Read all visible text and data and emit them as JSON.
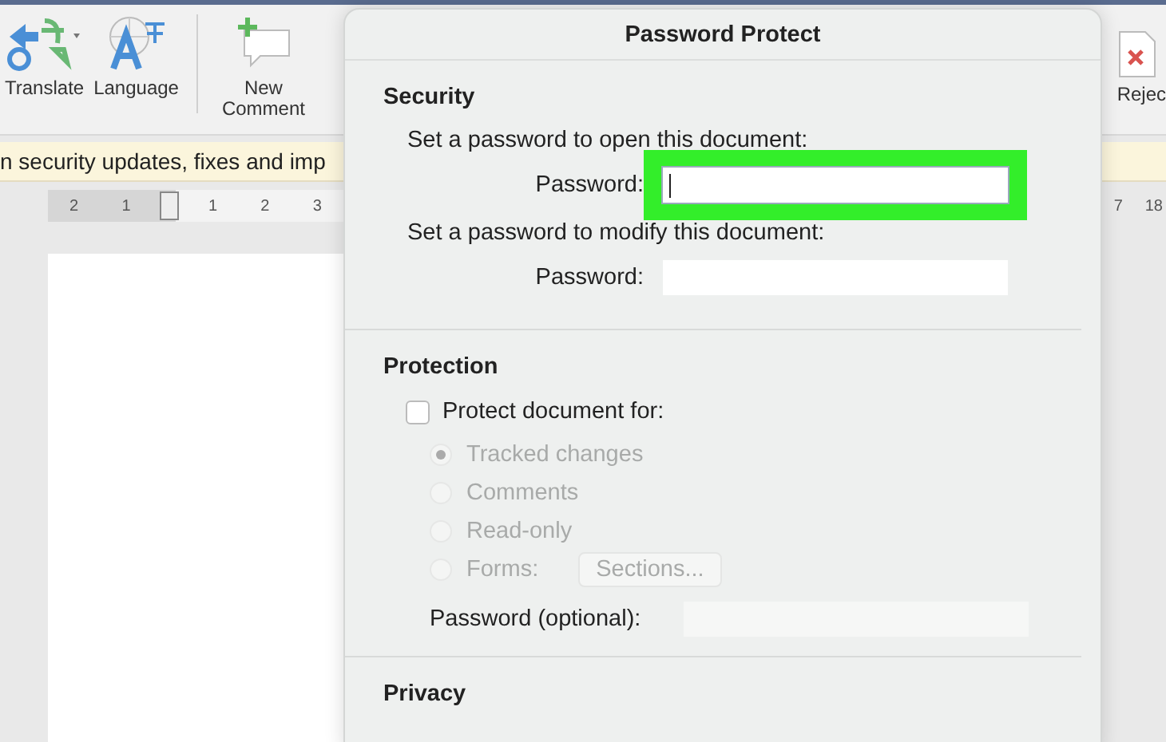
{
  "ribbon": {
    "buttons": [
      {
        "label": "Translate",
        "kind": "translate"
      },
      {
        "label": "Language",
        "kind": "language"
      },
      {
        "label": "New Comment",
        "kind": "comment"
      }
    ],
    "right_button": {
      "label": "Rejec"
    }
  },
  "message_bar": {
    "text": "n security updates, fixes and imp"
  },
  "ruler": {
    "left_numbers": [
      "2",
      "1",
      "1",
      "2",
      "3"
    ],
    "right_numbers": [
      "7",
      "18"
    ]
  },
  "dialog": {
    "title": "Password Protect",
    "security": {
      "heading": "Security",
      "open_label": "Set a password to open this document:",
      "open_field": {
        "label": "Password:",
        "focused": true,
        "highlighted": true
      },
      "modify_label": "Set a password to modify this document:",
      "modify_field": {
        "label": "Password:",
        "focused": false,
        "highlighted": false
      }
    },
    "protection": {
      "heading": "Protection",
      "checkbox": {
        "label": "Protect document for:",
        "checked": false
      },
      "options": [
        {
          "label": "Tracked changes",
          "selected": true,
          "disabled": true
        },
        {
          "label": "Comments",
          "selected": false,
          "disabled": true
        },
        {
          "label": "Read-only",
          "selected": false,
          "disabled": true
        },
        {
          "label": "Forms:",
          "selected": false,
          "disabled": true,
          "button": "Sections..."
        }
      ],
      "password_label": "Password (optional):"
    },
    "privacy": {
      "heading": "Privacy"
    }
  }
}
